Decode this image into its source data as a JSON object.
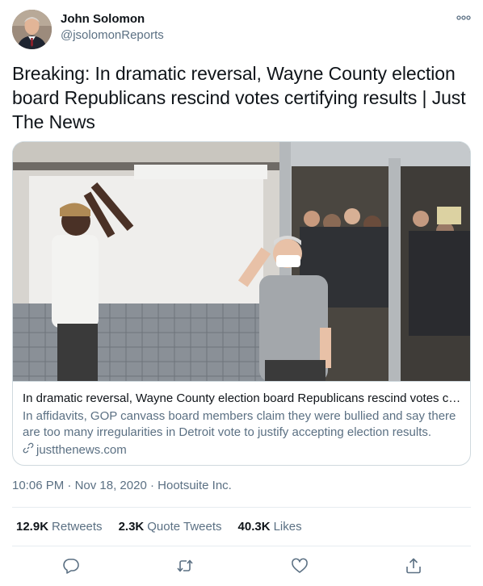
{
  "author": {
    "name": "John Solomon",
    "handle": "@jsolomonReports"
  },
  "tweet": {
    "text": "Breaking: In dramatic reversal, Wayne County election board Republicans rescind votes certifying results | Just The News"
  },
  "card": {
    "title": "In dramatic reversal, Wayne County election board Republicans rescind votes cert...",
    "description": "In affidavits, GOP canvass board members claim they were bullied and say there are too many irregularities in Detroit vote to justify accepting election results.",
    "domain": "justthenews.com"
  },
  "meta": {
    "time": "10:06 PM",
    "separator1": "·",
    "date": "Nov 18, 2020",
    "separator2": "·",
    "source": "Hootsuite Inc."
  },
  "stats": {
    "retweets_count": "12.9K",
    "retweets_label": "Retweets",
    "quotes_count": "2.3K",
    "quotes_label": "Quote Tweets",
    "likes_count": "40.3K",
    "likes_label": "Likes"
  },
  "icons": {
    "more": "more-icon",
    "reply": "reply-icon",
    "retweet": "retweet-icon",
    "like": "like-icon",
    "share": "share-icon",
    "link": "link-icon"
  },
  "colors": {
    "text": "#0f1419",
    "secondary": "#5b7083",
    "border": "#cfd9de"
  }
}
